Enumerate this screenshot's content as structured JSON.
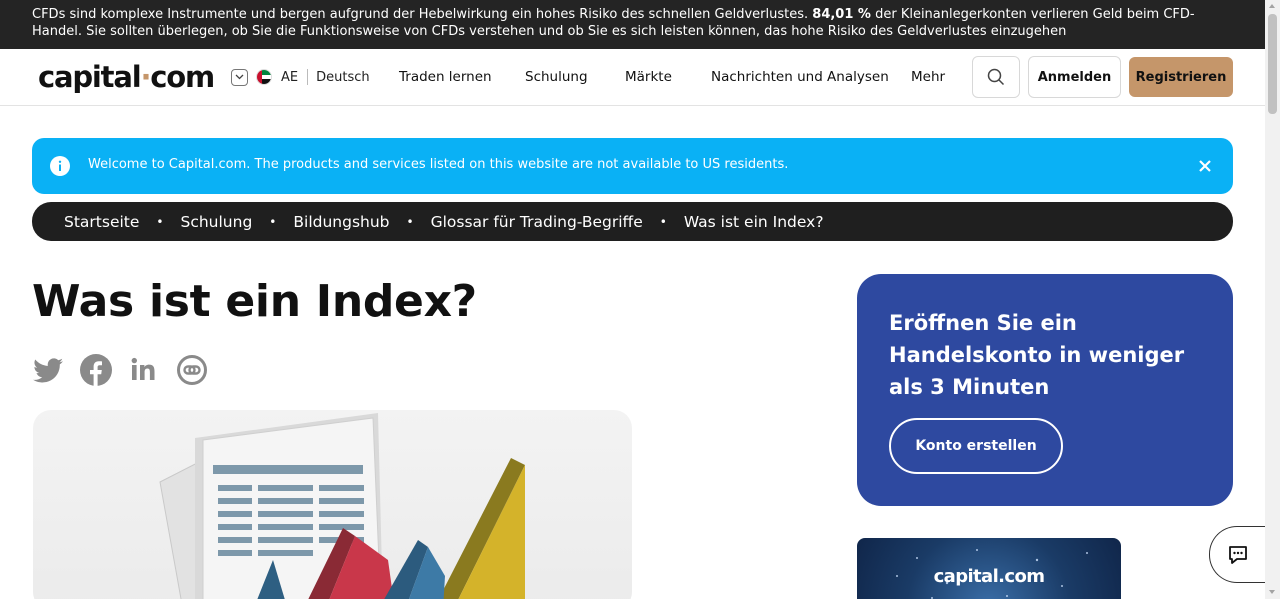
{
  "risk_warning": {
    "text_before": "CFDs sind komplexe Instrumente und bergen aufgrund der Hebelwirkung ein hohes Risiko des schnellen Geldverlustes. ",
    "percentage": "84,01 %",
    "text_after": " der Kleinanlegerkonten verlieren Geld beim CFD-Handel. Sie sollten überlegen, ob Sie die Funktionsweise von CFDs verstehen und ob Sie es sich leisten können, das hohe Risiko des Geldverlustes einzugehen"
  },
  "header": {
    "logo_left": "capital",
    "logo_dot": "·",
    "logo_right": "com",
    "region_code": "AE",
    "language": "Deutsch",
    "nav": [
      "Traden lernen",
      "Schulung",
      "Märkte",
      "Nachrichten und Analysen",
      "Mehr"
    ],
    "login_label": "Anmelden",
    "register_label": "Registrieren"
  },
  "banner": {
    "text": "Welcome to Capital.com. The products and services listed on this website are not available to US residents."
  },
  "breadcrumb": [
    "Startseite",
    "Schulung",
    "Bildungshub",
    "Glossar für Trading-Begriffe",
    "Was ist ein Index?"
  ],
  "breadcrumb_separator": "•",
  "article": {
    "title": "Was ist ein Index?"
  },
  "promo": {
    "heading": "Eröffnen Sie ein Handelskonto in weniger als 3 Minuten",
    "cta": "Konto erstellen"
  },
  "card2": {
    "brand": "capital.com"
  },
  "icons": {
    "share": [
      "twitter-icon",
      "facebook-icon",
      "linkedin-icon",
      "copy-link-icon"
    ]
  },
  "colors": {
    "accent": "#c5966a",
    "banner": "#0ab1f5",
    "promo": "#2e49a0",
    "dark": "#1f1f1f"
  }
}
